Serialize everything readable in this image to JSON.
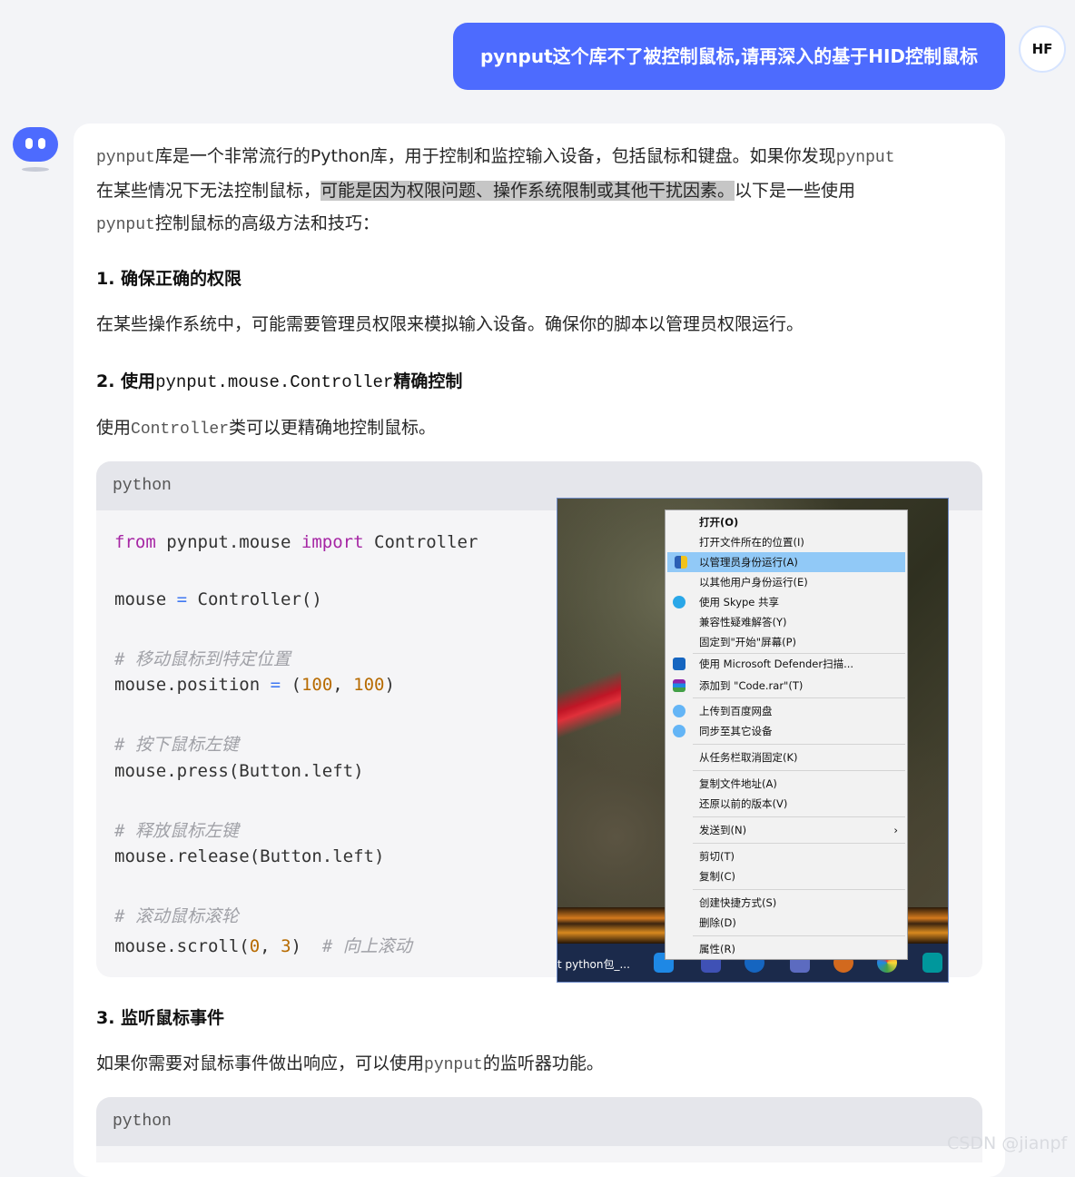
{
  "user_message": "pynput这个库不了被控制鼠标,请再深入的基于HID控制鼠标",
  "user_avatar": "HF",
  "answer": {
    "intro_part1_code": "pynput",
    "intro_part1": "库是一个非常流行的Python库，用于控制和监控输入设备，包括鼠标和键盘。如果你发现",
    "intro_part2_code": "pynput",
    "intro_part2": "在某些情况下无法控制鼠标，",
    "intro_highlight": "可能是因为权限问题、操作系统限制或其他干扰因素。",
    "intro_part3": "以下是一些使用",
    "intro_part4_code": "pynput",
    "intro_part4": "控制鼠标的高级方法和技巧：",
    "h1": "1. 确保正确的权限",
    "p1": "在某些操作系统中，可能需要管理员权限来模拟输入设备。确保你的脚本以管理员权限运行。",
    "h2_prefix": "2. 使用",
    "h2_code": "pynput.mouse.Controller",
    "h2_suffix": "精确控制",
    "p2_prefix": "使用",
    "p2_code": "Controller",
    "p2_suffix": "类可以更精确地控制鼠标。",
    "code1_lang": "python",
    "code1": {
      "l1_kw1": "from",
      "l1_a": " pynput.mouse ",
      "l1_kw2": "import",
      "l1_b": " Controller",
      "l2_a": "mouse ",
      "l2_op": "=",
      "l2_b": " Controller()",
      "c1": "# 移动鼠标到特定位置",
      "l3_a": "mouse.position ",
      "l3_op": "=",
      "l3_b": " (",
      "l3_n1": "100",
      "l3_c": ", ",
      "l3_n2": "100",
      "l3_d": ")",
      "c2": "# 按下鼠标左键",
      "l4": "mouse.press(Button.left)",
      "c3": "# 释放鼠标左键",
      "l5": "mouse.release(Button.left)",
      "c4": "# 滚动鼠标滚轮",
      "l6_a": "mouse.scroll(",
      "l6_n1": "0",
      "l6_b": ", ",
      "l6_n2": "3",
      "l6_c": ")  ",
      "l6_cm": "# 向上滚动"
    },
    "h3": "3. 监听鼠标事件",
    "p3_prefix": "如果你需要对鼠标事件做出响应，可以使用",
    "p3_code": "pynput",
    "p3_suffix": "的监听器功能。",
    "code2_lang": "python"
  },
  "context_menu": {
    "items": [
      "打开(O)",
      "打开文件所在的位置(I)",
      "以管理员身份运行(A)",
      "以其他用户身份运行(E)",
      "使用 Skype 共享",
      "兼容性疑难解答(Y)",
      "固定到\"开始\"屏幕(P)",
      "使用 Microsoft Defender扫描...",
      "添加到 \"Code.rar\"(T)",
      "上传到百度网盘",
      "同步至其它设备",
      "从任务栏取消固定(K)",
      "复制文件地址(A)",
      "还原以前的版本(V)",
      "发送到(N)",
      "剪切(T)",
      "复制(C)",
      "创建快捷方式(S)",
      "删除(D)",
      "属性(R)"
    ],
    "taskbar_text": "t python包_..."
  },
  "watermark": "CSDN @jianpf"
}
